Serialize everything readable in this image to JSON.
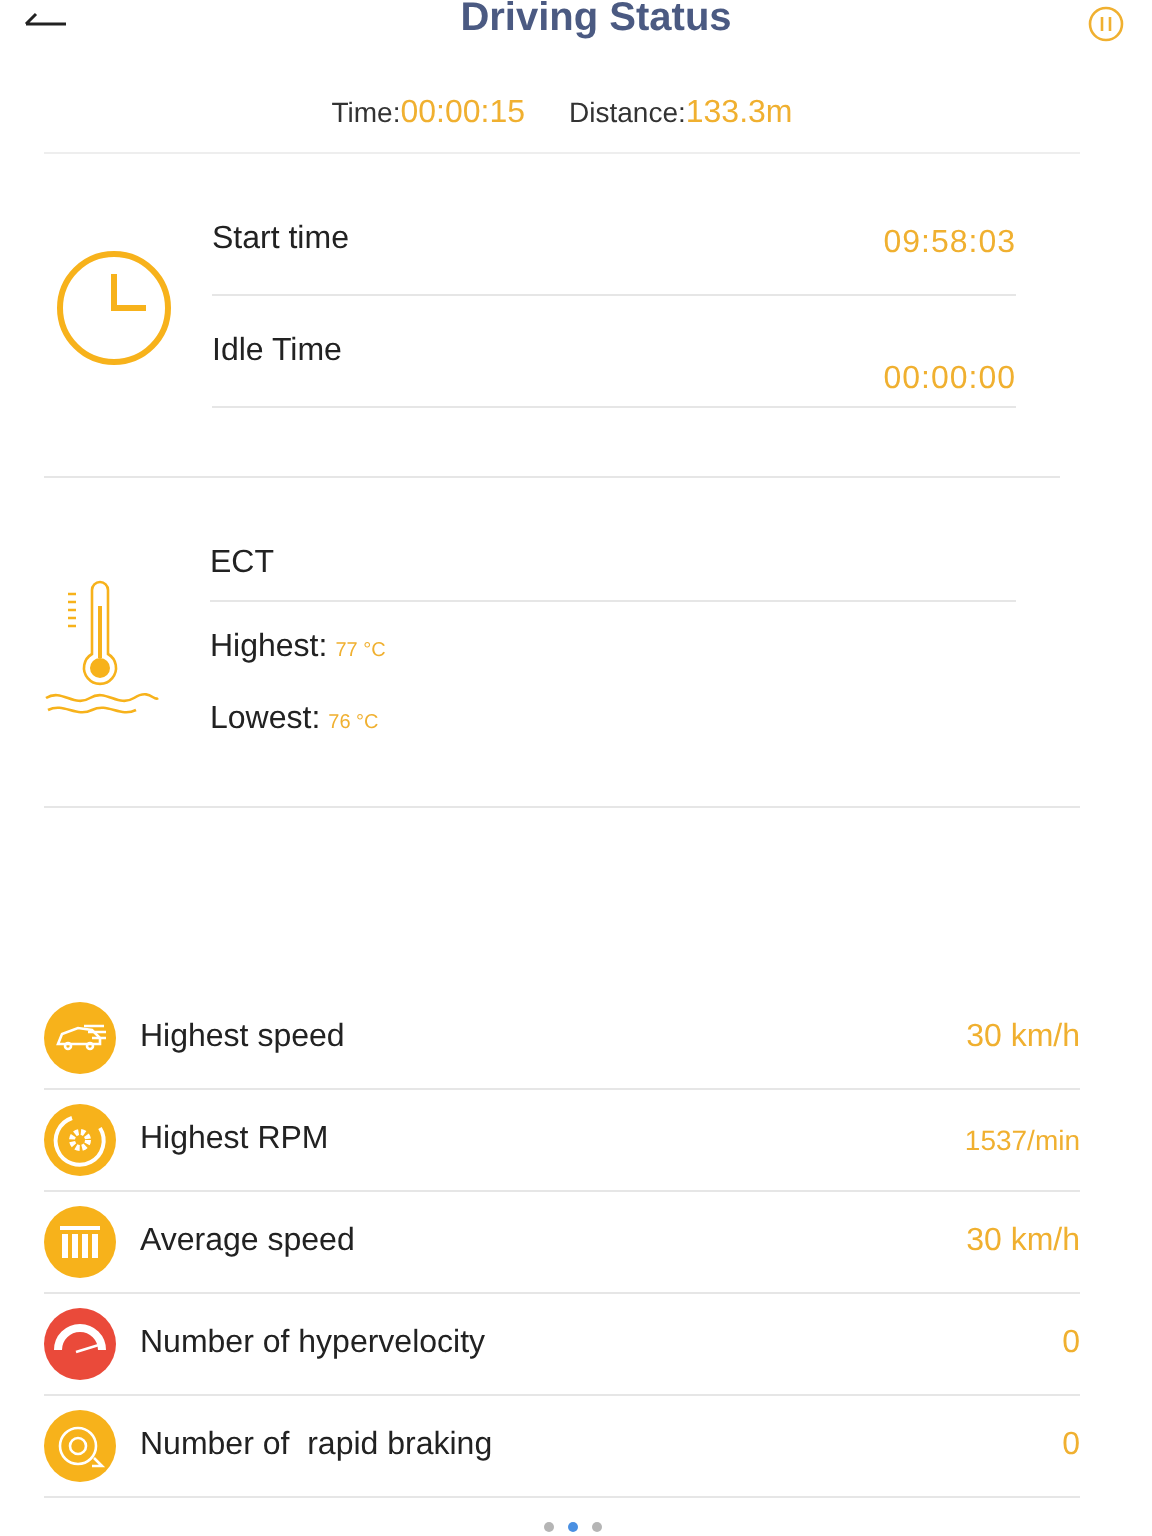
{
  "header": {
    "title": "Driving Status"
  },
  "summary": [
    {
      "label": "Time:",
      "value": "00:00:15"
    },
    {
      "label": "Distance:",
      "value": "133.3m"
    }
  ],
  "times": [
    {
      "label": "Start time",
      "value": "09:58:03"
    },
    {
      "label": "Idle Time",
      "value": "00:00:00"
    }
  ],
  "ect": {
    "title": "ECT",
    "readings": [
      {
        "label": "Highest:",
        "value": "77 °C"
      },
      {
        "label": "Lowest:",
        "value": "76 °C"
      }
    ]
  },
  "metrics": [
    {
      "kind": "car",
      "color": "#f7b21b",
      "label": "Highest speed",
      "value": "30 km/h"
    },
    {
      "kind": "gear",
      "color": "#f7b21b",
      "label": "Highest RPM",
      "value": "1537/min"
    },
    {
      "kind": "bars",
      "color": "#f7b21b",
      "label": "Average speed",
      "value": "30 km/h"
    },
    {
      "kind": "gauge",
      "color": "#ea4a3a",
      "label": "Number of hypervelocity",
      "value": "0"
    },
    {
      "kind": "brake",
      "color": "#f7b21b",
      "label": "Number of  rapid braking",
      "value": "0"
    }
  ],
  "pages": [
    {
      "selected": false
    },
    {
      "selected": true
    },
    {
      "selected": false
    }
  ]
}
